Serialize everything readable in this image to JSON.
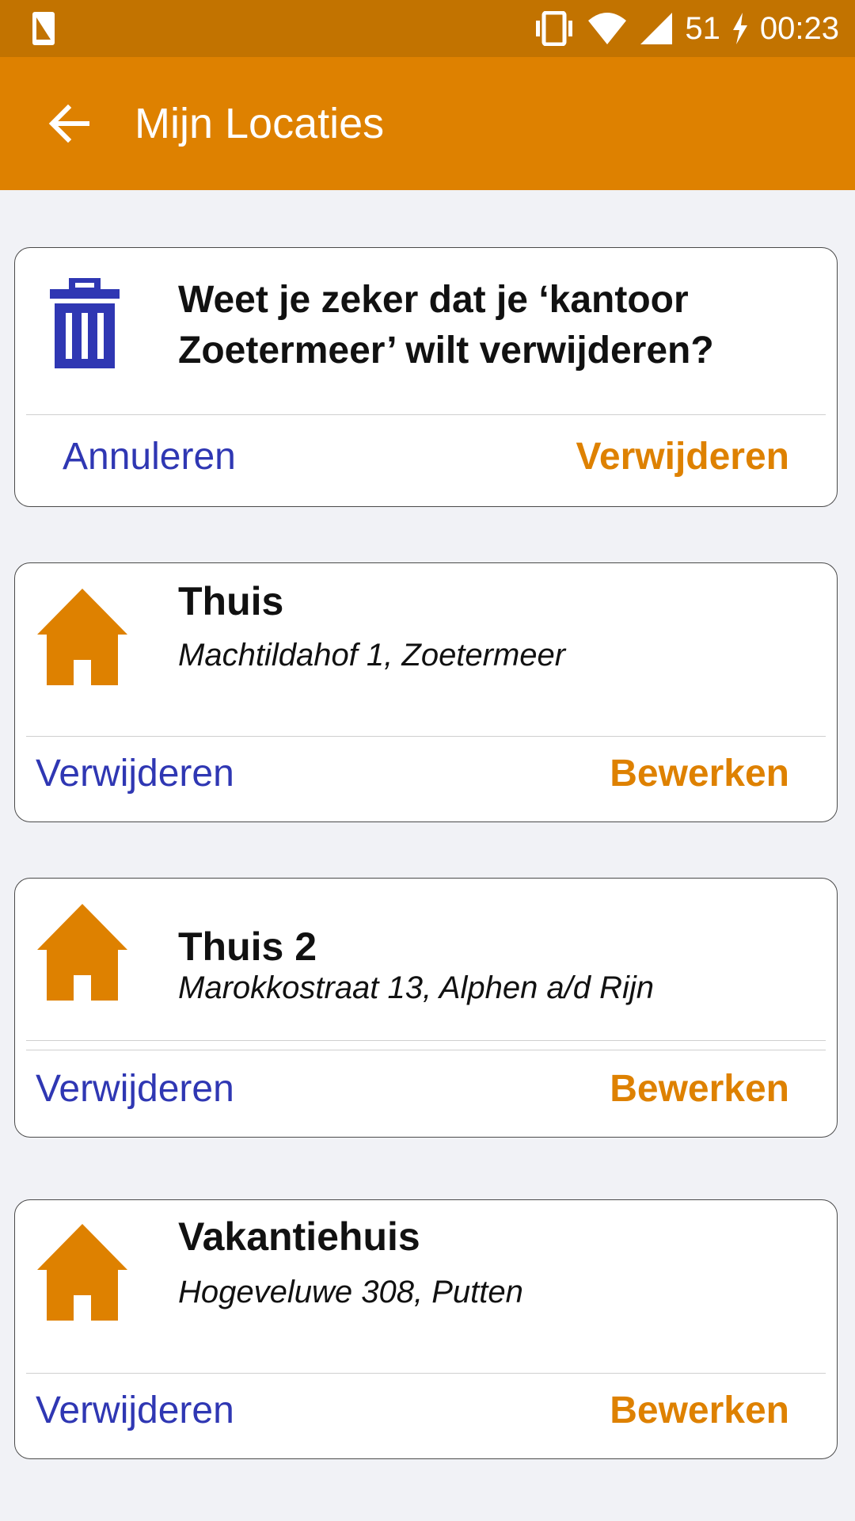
{
  "status_bar": {
    "battery": "51",
    "time": "00:23",
    "icons": [
      "screenshot-icon",
      "vibrate-icon",
      "wifi-icon",
      "signal-icon",
      "charging-icon"
    ]
  },
  "app_bar": {
    "title": "Mijn Locaties",
    "back_icon": "arrow-left-icon"
  },
  "confirm_dialog": {
    "message": "Weet je zeker dat je ‘kantoor Zoetermeer’ wilt verwijderen?",
    "cancel_label": "Annuleren",
    "confirm_label": "Verwijderen",
    "icon": "trash-icon"
  },
  "locations": [
    {
      "name": "Thuis",
      "address": "Machtildahof 1, Zoetermeer",
      "delete_label": "Verwijderen",
      "edit_label": "Bewerken",
      "icon": "house-icon"
    },
    {
      "name": "Thuis 2",
      "address": "Marokkostraat 13, Alphen a/d Rijn",
      "delete_label": "Verwijderen",
      "edit_label": "Bewerken",
      "icon": "house-icon"
    },
    {
      "name": "Vakantiehuis",
      "address": "Hogeveluwe 308, Putten",
      "delete_label": "Verwijderen",
      "edit_label": "Bewerken",
      "icon": "house-icon"
    }
  ],
  "colors": {
    "status_bar": "#c27300",
    "app_bar": "#de8100",
    "accent_orange": "#de8100",
    "accent_blue": "#2f37b3",
    "background": "#f1f2f6"
  }
}
